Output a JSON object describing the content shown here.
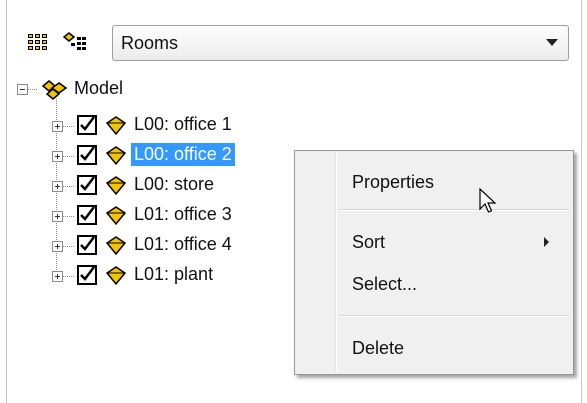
{
  "toolbar": {
    "grid_icon": "grid-icon",
    "tree_options_icon": "tree-options-icon",
    "view_selector": {
      "value": "Rooms"
    }
  },
  "tree": {
    "root": {
      "label": "Model",
      "expanded": true,
      "icon": "model-icon"
    },
    "items": [
      {
        "label": "L00: office 1",
        "checked": true,
        "selected": false
      },
      {
        "label": "L00: office 2",
        "checked": true,
        "selected": true
      },
      {
        "label": "L00: store",
        "checked": true,
        "selected": false
      },
      {
        "label": "L01: office 3",
        "checked": true,
        "selected": false
      },
      {
        "label": "L01: office 4",
        "checked": true,
        "selected": false
      },
      {
        "label": "L01: plant",
        "checked": true,
        "selected": false
      }
    ]
  },
  "context_menu": {
    "properties": "Properties",
    "sort": "Sort",
    "select": "Select...",
    "delete": "Delete"
  },
  "colors": {
    "selection": "#3399ff",
    "menu_bg": "#f0f0f0",
    "room_icon": "#f2c500"
  }
}
